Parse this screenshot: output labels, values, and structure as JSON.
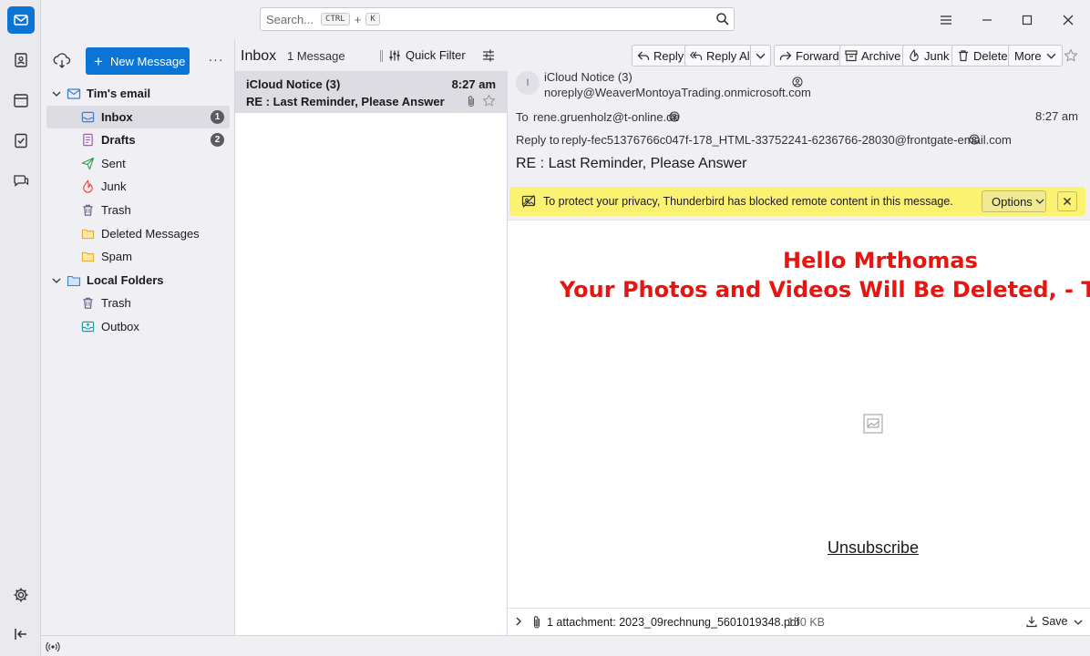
{
  "search": {
    "placeholder": "Search...",
    "key1": "CTRL",
    "plus": "+",
    "key2": "K"
  },
  "folder_pane": {
    "new_message_label": "New Message",
    "accounts": [
      {
        "name": "Tim's email",
        "folders": [
          {
            "label": "Inbox",
            "badge": "1",
            "icon": "inbox-icon",
            "bold": true,
            "selected": true
          },
          {
            "label": "Drafts",
            "badge": "2",
            "icon": "drafts-icon",
            "bold": true
          },
          {
            "label": "Sent",
            "icon": "sent-icon"
          },
          {
            "label": "Junk",
            "icon": "junk-icon"
          },
          {
            "label": "Trash",
            "icon": "trash-icon"
          },
          {
            "label": "Deleted Messages",
            "icon": "folder-icon"
          },
          {
            "label": "Spam",
            "icon": "folder-icon"
          }
        ]
      },
      {
        "name": "Local Folders",
        "folders": [
          {
            "label": "Trash",
            "icon": "trash-icon"
          },
          {
            "label": "Outbox",
            "icon": "outbox-icon"
          }
        ]
      }
    ]
  },
  "thread_pane": {
    "folder_title": "Inbox",
    "message_count": "1 Message",
    "quick_filter_label": "Quick Filter",
    "messages": [
      {
        "sender": "iCloud Notice (3)",
        "time": "8:27 am",
        "subject": "RE : Last Reminder, Please Answer",
        "has_attachment": true,
        "starred": false
      }
    ]
  },
  "message_pane": {
    "toolbar": {
      "reply": "Reply",
      "reply_all": "Reply All",
      "forward": "Forward",
      "archive": "Archive",
      "junk": "Junk",
      "delete": "Delete",
      "more": "More"
    },
    "header": {
      "avatar_initial": "I",
      "from_name": "iCloud Notice (3)",
      "from_address": "noreply@WeaverMontoyaTrading.onmicrosoft.com",
      "to_label": "To",
      "to_address": "rene.gruenholz@t-online.de",
      "time": "8:27 am",
      "reply_to_label": "Reply to",
      "reply_to_address": "reply-fec51376766c047f-178_HTML-33752241-6236766-28030@frontgate-email.com",
      "subject": "RE : Last Reminder, Please Answer"
    },
    "remote_content": {
      "text": "To protect your privacy, Thunderbird has blocked remote content in this message.",
      "options_label": "Options"
    },
    "body": {
      "line1": "Hello Mrthomas",
      "line2": "Your Photos and Videos Will Be Deleted, - Take",
      "unsubscribe": "Unsubscribe"
    },
    "attachments": {
      "summary": "1 attachment: 2023_09rechnung_5601019348.pdf",
      "size": "150 KB",
      "save_label": "Save"
    }
  },
  "colors": {
    "accent": "#0b74d4",
    "remote_bar": "#fcf272",
    "body_red": "#e8140f"
  }
}
